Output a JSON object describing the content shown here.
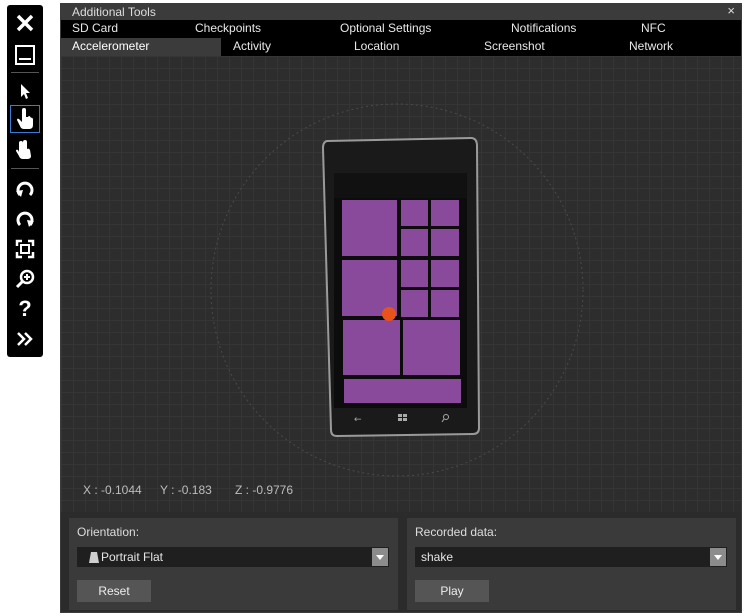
{
  "toolbar": {
    "items": [
      {
        "name": "close",
        "icon": "close-icon"
      },
      {
        "name": "minimize",
        "icon": "minimize-icon"
      },
      {
        "name": "pointer",
        "icon": "pointer-icon"
      },
      {
        "name": "single-point",
        "icon": "single-touch-icon",
        "selected": true
      },
      {
        "name": "multi-point",
        "icon": "multi-touch-icon"
      },
      {
        "name": "rotate-left",
        "icon": "rotate-left-icon"
      },
      {
        "name": "rotate-right",
        "icon": "rotate-right-icon"
      },
      {
        "name": "fit-to-screen",
        "icon": "fit-screen-icon"
      },
      {
        "name": "zoom",
        "icon": "zoom-icon"
      },
      {
        "name": "help",
        "icon": "help-icon"
      },
      {
        "name": "tools",
        "icon": "double-chevron-right-icon"
      }
    ]
  },
  "window": {
    "title": "Additional Tools",
    "close_glyph": "×"
  },
  "tabs_row1": [
    "SD Card",
    "Checkpoints",
    "Optional Settings",
    "Notifications",
    "NFC"
  ],
  "tabs_row2": [
    "Accelerometer",
    "Activity",
    "Location",
    "Screenshot",
    "Network"
  ],
  "active_tab": "Accelerometer",
  "readout": {
    "x": "X : -0.1044",
    "y": "Y : -0.183",
    "z": "Z : -0.9776"
  },
  "orientation": {
    "label": "Orientation:",
    "value": "Portrait Flat",
    "reset_label": "Reset"
  },
  "recorded": {
    "label": "Recorded data:",
    "value": "shake",
    "play_label": "Play"
  },
  "colors": {
    "tile": "#8a4a9c",
    "dot": "#e8531c",
    "selected_outline": "#3a7bd5"
  }
}
